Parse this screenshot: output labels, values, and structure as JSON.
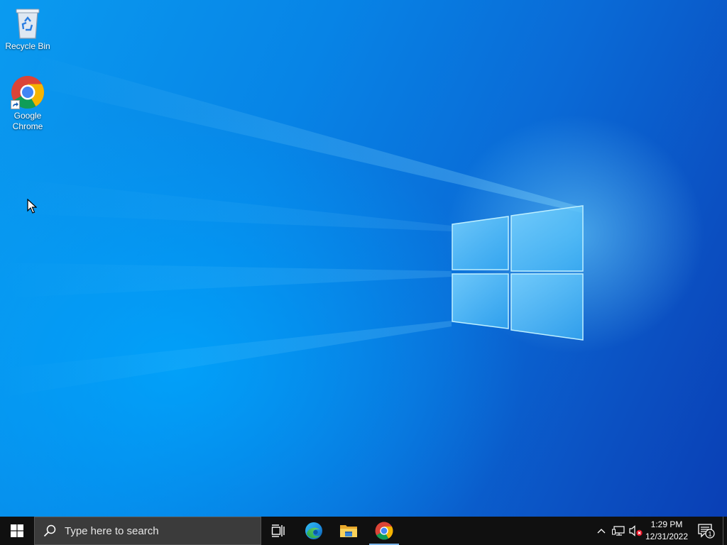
{
  "desktop": {
    "icons": [
      {
        "name": "recycle-bin",
        "label": "Recycle Bin"
      },
      {
        "name": "google-chrome",
        "label": "Google Chrome",
        "label_lines": [
          "Google",
          "Chrome"
        ]
      }
    ]
  },
  "taskbar": {
    "search": {
      "placeholder": "Type here to search"
    },
    "pinned_apps": [
      "task-view-icon",
      "microsoft-edge-icon",
      "file-explorer-icon",
      "google-chrome-icon"
    ],
    "tray": {
      "icons": [
        "chevron-up-icon",
        "network-icon",
        "volume-muted-icon"
      ],
      "time": "1:29 PM",
      "date": "12/31/2022",
      "notification_count": "1"
    }
  },
  "colors": {
    "taskbar": "#101010",
    "search_box": "#3b3b3b",
    "wallpaper_light": "#0a9bf0",
    "wallpaper_dark": "#0a3fb5"
  }
}
